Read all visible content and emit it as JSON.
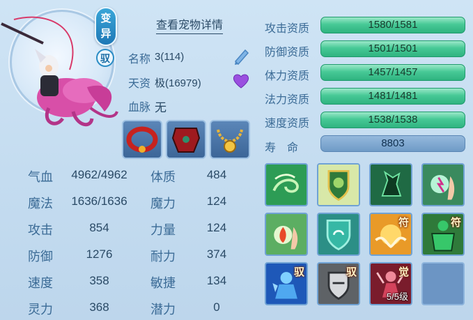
{
  "header": {
    "detail_link": "查看宠物详情"
  },
  "badges": {
    "variant": "变异",
    "ride": "驭"
  },
  "info": {
    "name_label": "名称",
    "name_value": "3(114)",
    "aptitude_label": "天资",
    "aptitude_value": "极(16979)",
    "bloodline_label": "血脉",
    "bloodline_value": "无"
  },
  "equipment": [
    {
      "icon": "red-collar-icon"
    },
    {
      "icon": "red-armor-icon"
    },
    {
      "icon": "gold-necklace-icon"
    }
  ],
  "stats_left": [
    {
      "label": "气血",
      "value": "4962/4962"
    },
    {
      "label": "魔法",
      "value": "1636/1636"
    },
    {
      "label": "攻击",
      "value": "854"
    },
    {
      "label": "防御",
      "value": "1276"
    },
    {
      "label": "速度",
      "value": "358"
    },
    {
      "label": "灵力",
      "value": "368"
    }
  ],
  "stats_right": [
    {
      "label": "体质",
      "value": "484"
    },
    {
      "label": "魔力",
      "value": "124"
    },
    {
      "label": "力量",
      "value": "124"
    },
    {
      "label": "耐力",
      "value": "374"
    },
    {
      "label": "敏捷",
      "value": "134"
    },
    {
      "label": "潜力",
      "value": "0"
    }
  ],
  "qualities": [
    {
      "label": "攻击资质",
      "value": "1580/1581",
      "fill": 1.0
    },
    {
      "label": "防御资质",
      "value": "1501/1501",
      "fill": 1.0
    },
    {
      "label": "体力资质",
      "value": "1457/1457",
      "fill": 1.0
    },
    {
      "label": "法力资质",
      "value": "1481/1481",
      "fill": 1.0
    },
    {
      "label": "速度资质",
      "value": "1538/1538",
      "fill": 1.0
    }
  ],
  "lifespan": {
    "label": "寿　命",
    "value": "8803"
  },
  "skills": [
    {
      "icon": "wind-swirl-icon",
      "tag": "",
      "level": ""
    },
    {
      "icon": "shield-emblem-icon",
      "tag": "",
      "level": ""
    },
    {
      "icon": "green-beast-icon",
      "tag": "",
      "level": ""
    },
    {
      "icon": "lightning-hand-icon",
      "tag": "",
      "level": ""
    },
    {
      "icon": "fire-hand-icon",
      "tag": "",
      "level": ""
    },
    {
      "icon": "green-shield-icon",
      "tag": "",
      "level": ""
    },
    {
      "icon": "golden-wings-icon",
      "tag": "符",
      "level": ""
    },
    {
      "icon": "green-giant-icon",
      "tag": "符",
      "level": ""
    },
    {
      "icon": "blue-warrior-icon",
      "tag": "驭",
      "level": ""
    },
    {
      "icon": "grey-shield-icon",
      "tag": "驭",
      "level": ""
    },
    {
      "icon": "red-figure-icon",
      "tag": "觉",
      "level": "5/5级"
    },
    {
      "icon": "empty-slot",
      "tag": "",
      "level": ""
    }
  ]
}
